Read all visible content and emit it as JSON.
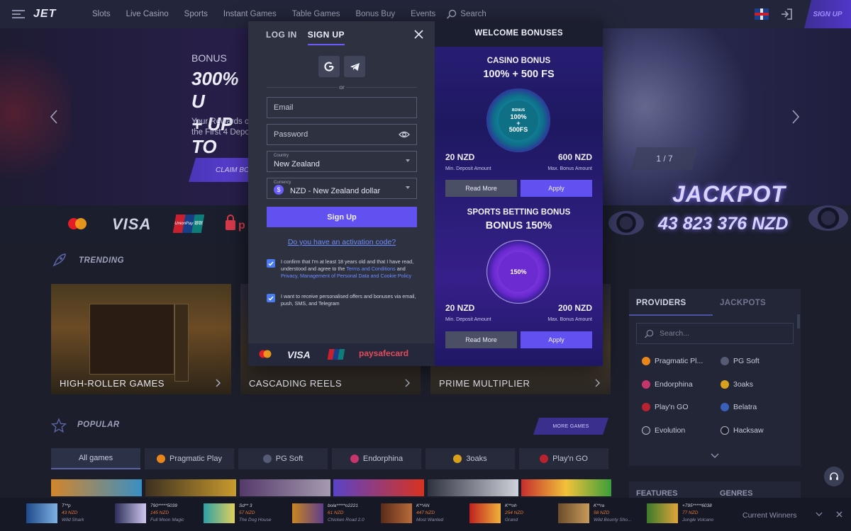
{
  "nav": {
    "logo": "JET",
    "links": [
      "Slots",
      "Live Casino",
      "Sports",
      "Instant Games",
      "Table Games",
      "Bonus Buy",
      "Events"
    ],
    "search": "Search",
    "signup": "SIGN UP"
  },
  "hero": {
    "bonus_label": "BONUS",
    "title_line1": "300% U",
    "title_line2": "+ UP TO",
    "desc_line1": "Your Rewards o",
    "desc_line2": "the First 4 Depo",
    "claim": "CLAIM BO",
    "slide": "1 / 7"
  },
  "jackpot": {
    "word": "JACKPOT",
    "amount": "43 823 376 NZD"
  },
  "payments": {
    "visa": "VISA",
    "unionpay": "UnionPay 银联",
    "paysafe": "paysafecard"
  },
  "trending": {
    "title": "TRENDING",
    "tiles": [
      "HIGH-ROLLER GAMES",
      "CASCADING REELS",
      "PRIME MULTIPLIER"
    ]
  },
  "popular": {
    "title": "POPULAR",
    "more": "MORE GAMES",
    "tabs": [
      "All games",
      "Pragmatic Play",
      "PG Soft",
      "Endorphina",
      "3oaks",
      "Play'n GO"
    ]
  },
  "providers": {
    "tab_active": "PROVIDERS",
    "tab_other": "JACKPOTS",
    "search_placeholder": "Search...",
    "items": [
      "Pragmatic Pl...",
      "PG Soft",
      "Endorphina",
      "3oaks",
      "Play'n GO",
      "Belatra",
      "Evolution",
      "Hacksaw"
    ]
  },
  "features": {
    "a": "FEATURES",
    "b": "GENRES"
  },
  "winners": {
    "label": "Current Winners",
    "items": [
      {
        "name": "T**p",
        "amount": "43 NZD",
        "game": "Wild Shark"
      },
      {
        "name": "790*****5039",
        "amount": "145 NZD",
        "game": "Full Moon Magic"
      },
      {
        "name": "Sd** 3",
        "amount": "57 NZD",
        "game": "The Dog House"
      },
      {
        "name": "bola*****o2221",
        "amount": "61 NZD",
        "game": "Chicken Road 2.0"
      },
      {
        "name": "K**AN",
        "amount": "447 NZD",
        "game": "Most Wanted"
      },
      {
        "name": "K**oh",
        "amount": "254 NZD",
        "game": "Grand"
      },
      {
        "name": "K**ra",
        "amount": "58 NZD",
        "game": "Wild Bounty Sho..."
      },
      {
        "name": "+795*****6038",
        "amount": "77 NZD",
        "game": "Jungle Volcano"
      }
    ]
  },
  "modal": {
    "tab_login": "LOG IN",
    "tab_signup": "SIGN UP",
    "or": "or",
    "email_placeholder": "Email",
    "password_placeholder": "Password",
    "country_label": "Country",
    "country_value": "New Zealand",
    "currency_label": "Currency",
    "currency_value": "NZD - New Zealand dollar",
    "submit": "Sign Up",
    "activation": "Do you have an activation code?",
    "consent1_a": "I confirm that I'm at least 18 years old and that I have read, understood and agree to the ",
    "consent1_link1": "Terms and Conditions",
    "consent1_and": " and ",
    "consent1_link2": "Privacy, Management of Personal Data and Cookie Policy",
    "consent2": "I want to receive personalised offers and bonuses via email, push, SMS, and Telegram",
    "consent1_checked": true,
    "consent2_checked": true,
    "pay_visa": "VISA",
    "pay_paysafe": "paysafecard"
  },
  "welcome": {
    "title": "WELCOME BONUSES",
    "casino": {
      "title": "CASINO BONUS",
      "subtitle": "100% + 500 FS",
      "badge_top": "BONUS",
      "badge_1": "100%",
      "badge_2": "+",
      "badge_3": "500FS",
      "min": "20 NZD",
      "min_label": "Min. Deposit Amount",
      "max": "600 NZD",
      "max_label": "Max. Bonus Amount",
      "read_more": "Read More",
      "apply": "Apply"
    },
    "sports": {
      "title": "SPORTS BETTING BONUS",
      "subtitle": "BONUS 150%",
      "badge_1": "150%",
      "min": "20 NZD",
      "min_label": "Min. Deposit Amount",
      "max": "200 NZD",
      "max_label": "Max. Bonus Amount",
      "read_more": "Read More",
      "apply": "Apply"
    }
  },
  "colors": {
    "accent": "#6151f0",
    "link": "#6e8cff",
    "panel": "#2d3140",
    "page": "#1c1f2b"
  }
}
